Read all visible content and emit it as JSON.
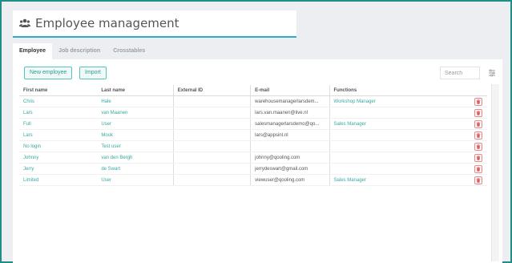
{
  "header": {
    "title": "Employee management",
    "icon": "people-icon"
  },
  "tabs": [
    {
      "label": "Employee",
      "active": true
    },
    {
      "label": "Job description",
      "active": false
    },
    {
      "label": "Crosstables",
      "active": false
    }
  ],
  "toolbar": {
    "new_label": "New employee",
    "import_label": "Import",
    "search_placeholder": "Search"
  },
  "table": {
    "columns": [
      "First name",
      "Last name",
      "External ID",
      "E-mail",
      "Functions"
    ],
    "rows": [
      {
        "first": "Chris",
        "last": "Hale",
        "external": "",
        "email": "warehousemanagerlarsdem...",
        "functions": "Workshop Manager"
      },
      {
        "first": "Lars",
        "last": "van Maanen",
        "external": "",
        "email": "lars.van.maanen@live.nl",
        "functions": ""
      },
      {
        "first": "Full",
        "last": "User",
        "external": "",
        "email": "salesmanagerlarsdemo@qo...",
        "functions": "Sales Manager"
      },
      {
        "first": "Lars",
        "last": "Mook",
        "external": "",
        "email": "lars@appsint.nl",
        "functions": ""
      },
      {
        "first": "No login",
        "last": "Test user",
        "external": "",
        "email": "",
        "functions": ""
      },
      {
        "first": "Johnny",
        "last": "van den Bergh",
        "external": "",
        "email": "johnny@qooling.com",
        "functions": ""
      },
      {
        "first": "Jerry",
        "last": "de Swart",
        "external": "",
        "email": "jerrydeswart@gmail.com",
        "functions": ""
      },
      {
        "first": "Limited",
        "last": "User",
        "external": "",
        "email": "viewuser@qooling.com",
        "functions": "Sales Manager"
      }
    ]
  },
  "colors": {
    "accent": "#3aa7a1",
    "title_underline": "#34a8c4",
    "delete": "#e05a5a",
    "frame": "#1f8f86"
  }
}
